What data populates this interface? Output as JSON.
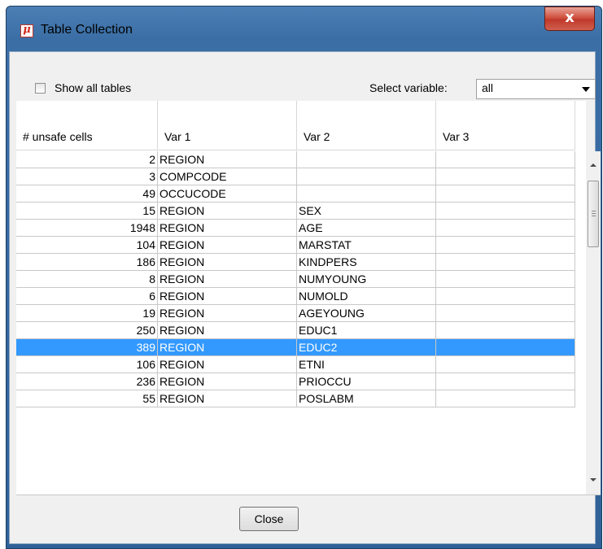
{
  "window": {
    "title": "Table Collection",
    "close_glyph": "x"
  },
  "toolbar": {
    "show_all_label": "Show all tables",
    "show_all_checked": false,
    "select_label": "Select variable:",
    "select_value": "all"
  },
  "table": {
    "columns": [
      "# unsafe cells",
      "Var 1",
      "Var 2",
      "Var 3"
    ],
    "rows": [
      {
        "unsafe": "2",
        "var1": "REGION",
        "var2": "",
        "var3": ""
      },
      {
        "unsafe": "3",
        "var1": "COMPCODE",
        "var2": "",
        "var3": ""
      },
      {
        "unsafe": "49",
        "var1": "OCCUCODE",
        "var2": "",
        "var3": ""
      },
      {
        "unsafe": "15",
        "var1": "REGION",
        "var2": "SEX",
        "var3": ""
      },
      {
        "unsafe": "1948",
        "var1": "REGION",
        "var2": "AGE",
        "var3": ""
      },
      {
        "unsafe": "104",
        "var1": "REGION",
        "var2": "MARSTAT",
        "var3": ""
      },
      {
        "unsafe": "186",
        "var1": "REGION",
        "var2": "KINDPERS",
        "var3": ""
      },
      {
        "unsafe": "8",
        "var1": "REGION",
        "var2": "NUMYOUNG",
        "var3": ""
      },
      {
        "unsafe": "6",
        "var1": "REGION",
        "var2": "NUMOLD",
        "var3": ""
      },
      {
        "unsafe": "19",
        "var1": "REGION",
        "var2": "AGEYOUNG",
        "var3": ""
      },
      {
        "unsafe": "250",
        "var1": "REGION",
        "var2": "EDUC1",
        "var3": ""
      },
      {
        "unsafe": "389",
        "var1": "REGION",
        "var2": "EDUC2",
        "var3": ""
      },
      {
        "unsafe": "106",
        "var1": "REGION",
        "var2": "ETNI",
        "var3": ""
      },
      {
        "unsafe": "236",
        "var1": "REGION",
        "var2": "PRIOCCU",
        "var3": ""
      },
      {
        "unsafe": "55",
        "var1": "REGION",
        "var2": "POSLABM",
        "var3": ""
      }
    ],
    "selected_row": "389 REGION EDUC2"
  },
  "footer": {
    "close_label": "Close"
  },
  "colors": {
    "selection": "#3399ff",
    "titlebar": "#3a6ea5",
    "close_button": "#c0392b"
  },
  "icons": {
    "app_icon": "mu-argus-icon",
    "close_icon": "close-icon"
  }
}
